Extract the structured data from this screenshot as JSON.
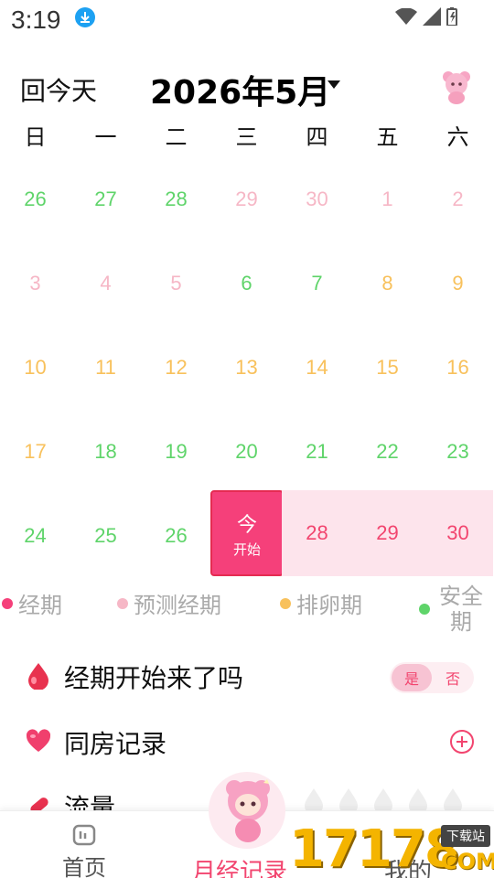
{
  "status_bar": {
    "time": "3:19"
  },
  "header": {
    "today_label": "回今天",
    "month_title": "2026年5月"
  },
  "weekdays": [
    "日",
    "一",
    "二",
    "三",
    "四",
    "五",
    "六"
  ],
  "calendar": {
    "weeks": [
      [
        {
          "day": "26",
          "status": "green"
        },
        {
          "day": "27",
          "status": "green"
        },
        {
          "day": "28",
          "status": "green"
        },
        {
          "day": "29",
          "status": "pink"
        },
        {
          "day": "30",
          "status": "pink"
        },
        {
          "day": "1",
          "status": "pink"
        },
        {
          "day": "2",
          "status": "pink"
        }
      ],
      [
        {
          "day": "3",
          "status": "pink"
        },
        {
          "day": "4",
          "status": "pink"
        },
        {
          "day": "5",
          "status": "pink"
        },
        {
          "day": "6",
          "status": "green"
        },
        {
          "day": "7",
          "status": "green"
        },
        {
          "day": "8",
          "status": "orange"
        },
        {
          "day": "9",
          "status": "orange"
        }
      ],
      [
        {
          "day": "10",
          "status": "orange"
        },
        {
          "day": "11",
          "status": "orange"
        },
        {
          "day": "12",
          "status": "orange"
        },
        {
          "day": "13",
          "status": "orange"
        },
        {
          "day": "14",
          "status": "orange"
        },
        {
          "day": "15",
          "status": "orange"
        },
        {
          "day": "16",
          "status": "orange"
        }
      ],
      [
        {
          "day": "17",
          "status": "orange"
        },
        {
          "day": "18",
          "status": "green"
        },
        {
          "day": "19",
          "status": "green"
        },
        {
          "day": "20",
          "status": "green"
        },
        {
          "day": "21",
          "status": "green"
        },
        {
          "day": "22",
          "status": "green"
        },
        {
          "day": "23",
          "status": "green"
        }
      ],
      [
        {
          "day": "24",
          "status": "green"
        },
        {
          "day": "25",
          "status": "green"
        },
        {
          "day": "26",
          "status": "green"
        },
        {
          "day": "今",
          "status": "today",
          "sub": "开始"
        },
        {
          "day": "28",
          "status": "predicted"
        },
        {
          "day": "29",
          "status": "predicted"
        },
        {
          "day": "30",
          "status": "predicted"
        }
      ]
    ]
  },
  "legend": [
    {
      "label": "经期",
      "color": "#f5407a"
    },
    {
      "label": "预测经期",
      "color": "#f6b7c6"
    },
    {
      "label": "排卵期",
      "color": "#f8c15c"
    },
    {
      "label": "安全期",
      "color": "#5fd46a"
    }
  ],
  "rows": {
    "period_start": {
      "label": "经期开始来了吗",
      "yes": "是",
      "no": "否"
    },
    "intimacy": {
      "label": "同房记录"
    },
    "flow": {
      "label": "流量"
    }
  },
  "bottom_nav": {
    "home": "首页",
    "record": "月经记录",
    "mine": "我的"
  },
  "watermark": {
    "number": "17178",
    "tag": "下载站",
    "suffix": "COM"
  },
  "colors": {
    "accent": "#f5407a",
    "green": "#5fd46a",
    "pink": "#f6b7c6",
    "orange": "#f8c15c"
  }
}
